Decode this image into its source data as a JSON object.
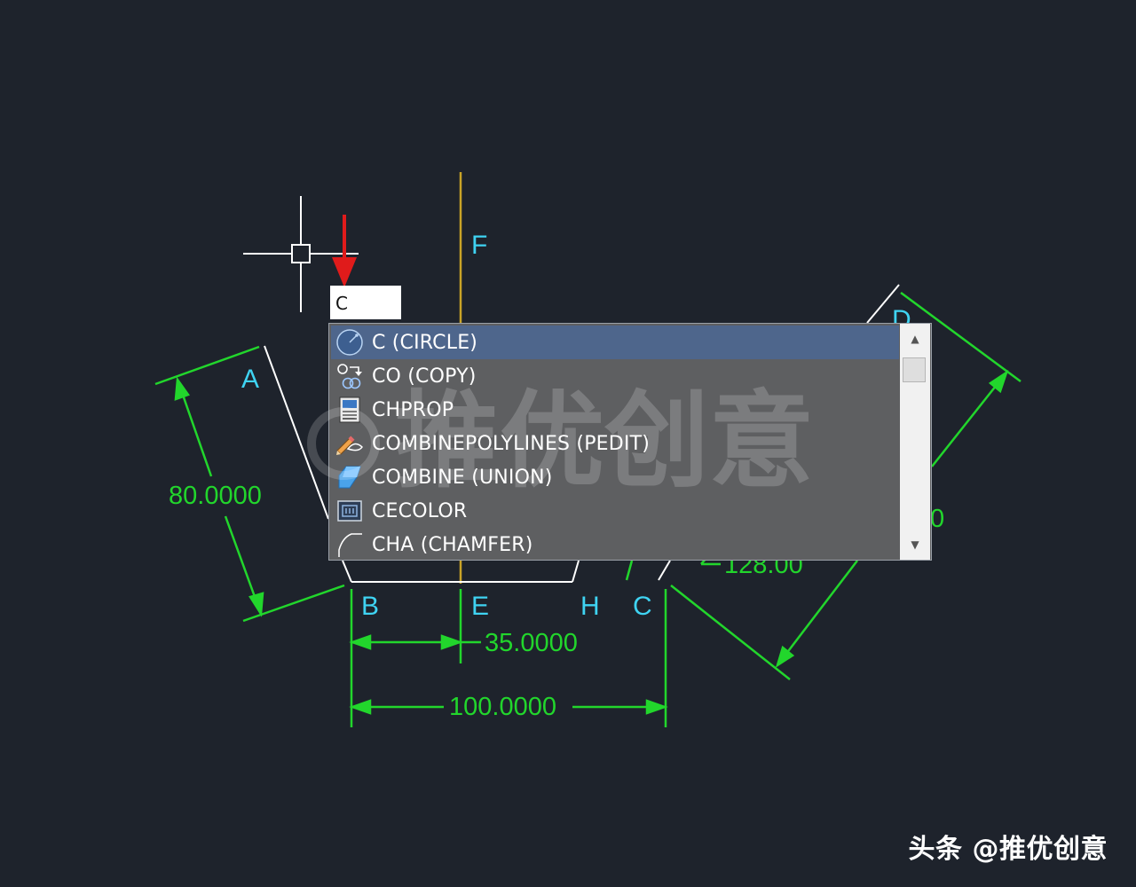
{
  "drawing": {
    "point_labels": {
      "A": "A",
      "B": "B",
      "C": "C",
      "D": "D",
      "E": "E",
      "F": "F",
      "H": "H"
    },
    "dimensions": {
      "left_height": "80.0000",
      "bottom_short": "35.0000",
      "bottom_long": "100.0000",
      "right_partial": "128.00",
      "right_cutoff": "0"
    }
  },
  "command_input": {
    "value": "C"
  },
  "autocomplete": {
    "items": [
      {
        "label": "C (CIRCLE)",
        "icon": "circle-icon",
        "selected": true
      },
      {
        "label": "CO (COPY)",
        "icon": "copy-icon",
        "selected": false
      },
      {
        "label": "CHPROP",
        "icon": "properties-icon",
        "selected": false
      },
      {
        "label": "COMBINEPOLYLINES (PEDIT)",
        "icon": "pencil-polyline-icon",
        "selected": false
      },
      {
        "label": "COMBINE (UNION)",
        "icon": "union-icon",
        "selected": false
      },
      {
        "label": "CECOLOR",
        "icon": "color-icon",
        "selected": false
      },
      {
        "label": "CHA (CHAMFER)",
        "icon": "chamfer-icon",
        "selected": false
      }
    ]
  },
  "watermark": "推优创意",
  "credit": "头条 @推优创意",
  "colors": {
    "background": "#1e232c",
    "selection": "#4e668c",
    "list_bg": "#5e5f61",
    "dimension": "#22d62c",
    "label": "#3fd3f2",
    "annotation_arrow": "#e01b1b"
  }
}
